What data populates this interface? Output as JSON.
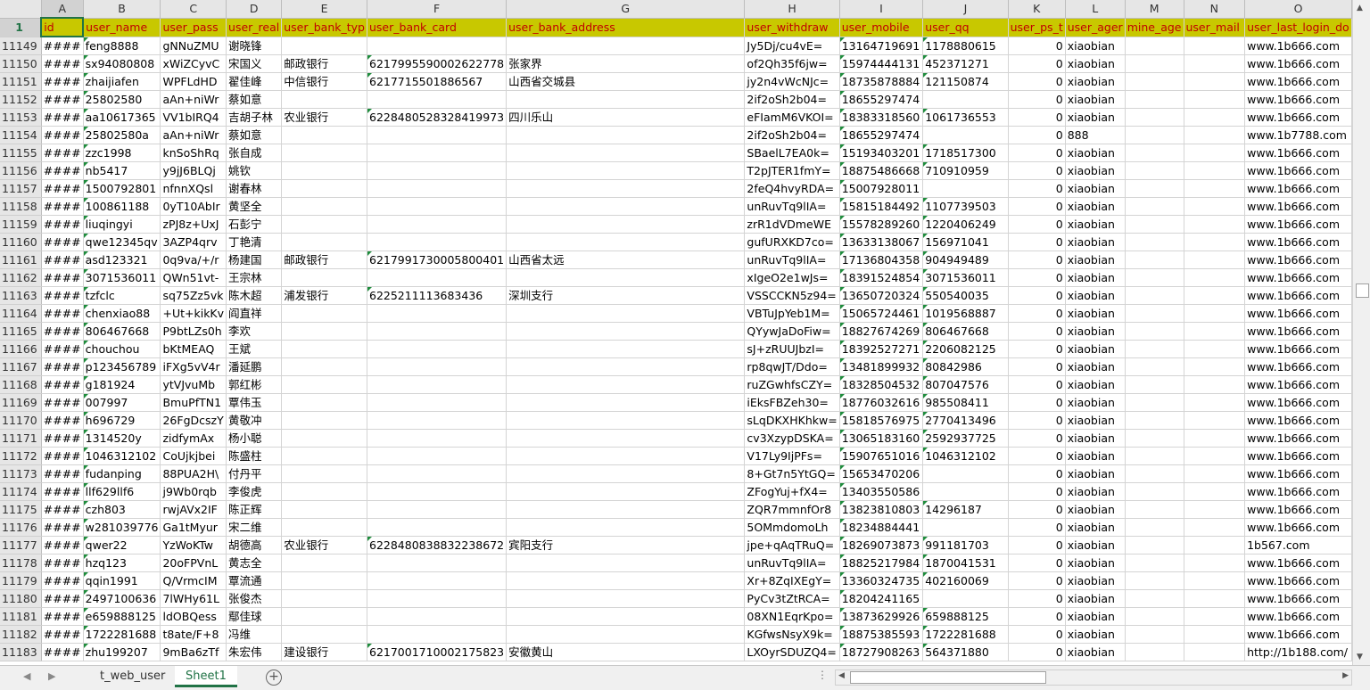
{
  "columns": [
    "A",
    "B",
    "C",
    "D",
    "E",
    "F",
    "G",
    "H",
    "I",
    "J",
    "K",
    "L",
    "M",
    "N",
    "O"
  ],
  "header_row_number": "1",
  "header": [
    "id",
    "user_name",
    "user_pass",
    "user_real",
    "user_bank_typ",
    "user_bank_card",
    "user_bank_address",
    "user_withdraw",
    "user_mobile",
    "user_qq",
    "user_ps_t",
    "user_ager",
    "mine_age",
    "user_mail",
    "user_last_login_do"
  ],
  "rows": [
    {
      "n": "11149",
      "c": [
        "####",
        "feng8888",
        "gNNuZMU",
        "谢晓锋",
        "",
        "",
        "",
        "Jy5Dj/cu4vE=",
        "13164719691",
        "1178880615",
        "0",
        "xiaobian",
        "",
        "",
        "www.1b666.com"
      ]
    },
    {
      "n": "11150",
      "c": [
        "####",
        "sx94080808",
        "xWiZCyvC",
        "宋国义",
        "邮政银行",
        "6217995590002622778",
        "张家界",
        "of2Qh35f6jw=",
        "15974444131",
        "452371271",
        "0",
        "xiaobian",
        "",
        "",
        "www.1b666.com"
      ]
    },
    {
      "n": "11151",
      "c": [
        "####",
        "zhaijiafen",
        "WPFLdHD",
        "翟佳峰",
        "中信银行",
        "621771550188​6567",
        "山西省交城县",
        "jy2n4vWcNJc=",
        "18735878884",
        "121150874",
        "0",
        "xiaobian",
        "",
        "",
        "www.1b666.com"
      ]
    },
    {
      "n": "11152",
      "c": [
        "####",
        "25802580",
        "aAn+niWr",
        "蔡如意",
        "",
        "",
        "",
        "2if2oSh2b04=",
        "18655297474",
        "",
        "0",
        "xiaobian",
        "",
        "",
        "www.1b666.com"
      ]
    },
    {
      "n": "11153",
      "c": [
        "####",
        "aa10617365",
        "VV1bIRQ4",
        "吉胡子林",
        "农业银行",
        "6228480528328419973",
        "四川乐山",
        "eFIamM6VKOI=",
        "18383318560",
        "1061736553",
        "0",
        "xiaobian",
        "",
        "",
        "www.1b666.com"
      ]
    },
    {
      "n": "11154",
      "c": [
        "####",
        "25802580a",
        "aAn+niWr",
        "蔡如意",
        "",
        "",
        "",
        "2if2oSh2b04=",
        "18655297474",
        "",
        "0",
        "888",
        "",
        "",
        "www.1b7788.com"
      ]
    },
    {
      "n": "11155",
      "c": [
        "####",
        "zzc1998",
        "knSoShRq",
        "张自成",
        "",
        "",
        "",
        "SBaelL7EA0k=",
        "15193403201",
        "1718517300",
        "0",
        "xiaobian",
        "",
        "",
        "www.1b666.com"
      ]
    },
    {
      "n": "11156",
      "c": [
        "####",
        "nb5417",
        "y9jJ6BLQj",
        "姚钦",
        "",
        "",
        "",
        "T2pJTER1fmY=",
        "18875486668",
        "710910959",
        "0",
        "xiaobian",
        "",
        "",
        "www.1b666.com"
      ]
    },
    {
      "n": "11157",
      "c": [
        "####",
        "1500792801",
        "nfnnXQsl",
        "谢春林",
        "",
        "",
        "",
        "2feQ4hvyRDA=",
        "15007928011",
        "",
        "0",
        "xiaobian",
        "",
        "",
        "www.1b666.com"
      ]
    },
    {
      "n": "11158",
      "c": [
        "####",
        "100861188",
        "0yT10AbIr",
        "黄坚全",
        "",
        "",
        "",
        "unRuvTq9lIA=",
        "15815184492",
        "1107739503",
        "0",
        "xiaobian",
        "",
        "",
        "www.1b666.com"
      ]
    },
    {
      "n": "11159",
      "c": [
        "####",
        "liuqingyi",
        "zPJ8z+UxJ",
        "石彭宁",
        "",
        "",
        "",
        "zrR1dVDmeWE",
        "15578289260",
        "1220406249",
        "0",
        "xiaobian",
        "",
        "",
        "www.1b666.com"
      ]
    },
    {
      "n": "11160",
      "c": [
        "####",
        "qwe12345qv",
        "3AZP4qrv",
        "丁艳清",
        "",
        "",
        "",
        "gufURXKD7co=",
        "13633138067",
        "156971041",
        "0",
        "xiaobian",
        "",
        "",
        "www.1b666.com"
      ]
    },
    {
      "n": "11161",
      "c": [
        "####",
        "asd123321",
        "0q9va/+/r",
        "杨建国",
        "邮政银行",
        "6217991730005800401",
        "山西省太远",
        "unRuvTq9lIA=",
        "17136804358",
        "904949489",
        "0",
        "xiaobian",
        "",
        "",
        "www.1b666.com"
      ]
    },
    {
      "n": "11162",
      "c": [
        "####",
        "3071536011",
        "QWn51vt-",
        "王宗林",
        "",
        "",
        "",
        "xIgeO2e1wJs=",
        "18391524854",
        "3071536011",
        "0",
        "xiaobian",
        "",
        "",
        "www.1b666.com"
      ]
    },
    {
      "n": "11163",
      "c": [
        "####",
        "tzfclc",
        "sq75Zz5vk",
        "陈木超",
        "浦发银行",
        "6225211113683436",
        "深圳支行",
        "VSSCCKN5z94=",
        "13650720324",
        "550540035",
        "0",
        "xiaobian",
        "",
        "",
        "www.1b666.com"
      ]
    },
    {
      "n": "11164",
      "c": [
        "####",
        "chenxiao88",
        "+Ut+kikKv",
        "阎直祥",
        "",
        "",
        "",
        "VBTuJpYeb1M=",
        "15065724461",
        "1019568887",
        "0",
        "xiaobian",
        "",
        "",
        "www.1b666.com"
      ]
    },
    {
      "n": "11165",
      "c": [
        "####",
        "806467668",
        "P9btLZs0h",
        "李欢",
        "",
        "",
        "",
        "QYywJaDoFiw=",
        "18827674269",
        "806467668",
        "0",
        "xiaobian",
        "",
        "",
        "www.1b666.com"
      ]
    },
    {
      "n": "11166",
      "c": [
        "####",
        "chouchou",
        "bKtMEAQ",
        "王斌",
        "",
        "",
        "",
        "sJ+zRUUJbzI=",
        "18392527271",
        "2206082125",
        "0",
        "xiaobian",
        "",
        "",
        "www.1b666.com"
      ]
    },
    {
      "n": "11167",
      "c": [
        "####",
        "p123456789",
        "iFXg5vV4r",
        "潘延鹏",
        "",
        "",
        "",
        "rp8qwJT/Ddo=",
        "13481899932",
        "80842986",
        "0",
        "xiaobian",
        "",
        "",
        "www.1b666.com"
      ]
    },
    {
      "n": "11168",
      "c": [
        "####",
        "g181924",
        "ytVJvuMb",
        "郭红彬",
        "",
        "",
        "",
        "ruZGwhfsCZY=",
        "18328504532",
        "807047576",
        "0",
        "xiaobian",
        "",
        "",
        "www.1b666.com"
      ]
    },
    {
      "n": "11169",
      "c": [
        "####",
        "007997",
        "BmuPfTN1",
        "覃伟玉",
        "",
        "",
        "",
        "iEksFBZeh30=",
        "18776032616",
        "985508411",
        "0",
        "xiaobian",
        "",
        "",
        "www.1b666.com"
      ]
    },
    {
      "n": "11170",
      "c": [
        "####",
        "h696729",
        "26FgDcszY",
        "黄敬冲",
        "",
        "",
        "",
        "sLqDKXHKhkw=",
        "15818576975",
        "2770413496",
        "0",
        "xiaobian",
        "",
        "",
        "www.1b666.com"
      ]
    },
    {
      "n": "11171",
      "c": [
        "####",
        "1314520y",
        "zidfymAx",
        "杨小聪",
        "",
        "",
        "",
        "cv3XzypDSKA=",
        "13065183160",
        "2592937725",
        "0",
        "xiaobian",
        "",
        "",
        "www.1b666.com"
      ]
    },
    {
      "n": "11172",
      "c": [
        "####",
        "1046312102",
        "CoUjkjbei",
        "陈盛柱",
        "",
        "",
        "",
        "V17Ly9IjPFs=",
        "15907651016",
        "1046312102",
        "0",
        "xiaobian",
        "",
        "",
        "www.1b666.com"
      ]
    },
    {
      "n": "11173",
      "c": [
        "####",
        "fudanping",
        "88PUA2H\\",
        "付丹平",
        "",
        "",
        "",
        "8+Gt7n5YtGQ=",
        "15653470206",
        "",
        "0",
        "xiaobian",
        "",
        "",
        "www.1b666.com"
      ]
    },
    {
      "n": "11174",
      "c": [
        "####",
        "llf629llf6",
        "j9Wb0rqb",
        "李俊虎",
        "",
        "",
        "",
        "ZFogYuj+fX4=",
        "13403550586",
        "",
        "0",
        "xiaobian",
        "",
        "",
        "www.1b666.com"
      ]
    },
    {
      "n": "11175",
      "c": [
        "####",
        "czh803",
        "rwjAVx2IF",
        "陈正辉",
        "",
        "",
        "",
        "ZQR7mmnfOr8",
        "13823810803",
        "14296187",
        "0",
        "xiaobian",
        "",
        "",
        "www.1b666.com"
      ]
    },
    {
      "n": "11176",
      "c": [
        "####",
        "w281039776",
        "Ga1tMyur",
        "宋二维",
        "",
        "",
        "",
        "5OMmdomoLh",
        "18234884441",
        "",
        "0",
        "xiaobian",
        "",
        "",
        "www.1b666.com"
      ]
    },
    {
      "n": "11177",
      "c": [
        "####",
        "qwer22",
        "YzWoKTw",
        "胡德高",
        "农业银行",
        "6228480838832238672",
        "宾阳支行",
        "jpe+qAqTRuQ=",
        "18269073873",
        "991181703",
        "0",
        "xiaobian",
        "",
        "",
        "1b567.com"
      ]
    },
    {
      "n": "11178",
      "c": [
        "####",
        "hzq123",
        "20oFPVnL",
        "黄志全",
        "",
        "",
        "",
        "unRuvTq9lIA=",
        "18825217984",
        "1870041531",
        "0",
        "xiaobian",
        "",
        "",
        "www.1b666.com"
      ]
    },
    {
      "n": "11179",
      "c": [
        "####",
        "qqin1991",
        "Q/VrmcIM",
        "覃流通",
        "",
        "",
        "",
        "Xr+8ZqIXEgY=",
        "13360324735",
        "402160069",
        "0",
        "xiaobian",
        "",
        "",
        "www.1b666.com"
      ]
    },
    {
      "n": "11180",
      "c": [
        "####",
        "2497100636",
        "7lWHy61L",
        "张俊杰",
        "",
        "",
        "",
        "PyCv3tZtRCA=",
        "18204241165",
        "",
        "0",
        "xiaobian",
        "",
        "",
        "www.1b666.com"
      ]
    },
    {
      "n": "11181",
      "c": [
        "####",
        "e659888125",
        "ldOBQess",
        "鄢佳球",
        "",
        "",
        "",
        "08XN1EqrKpo=",
        "13873629926",
        "659888125",
        "0",
        "xiaobian",
        "",
        "",
        "www.1b666.com"
      ]
    },
    {
      "n": "11182",
      "c": [
        "####",
        "1722281688",
        "t8ate/F+8",
        "冯维",
        "",
        "",
        "",
        "KGfwsNsyX9k=",
        "18875385593",
        "1722281688",
        "0",
        "xiaobian",
        "",
        "",
        "www.1b666.com"
      ]
    },
    {
      "n": "11183",
      "c": [
        "####",
        "zhu199207",
        "9mBa6zTf",
        "朱宏伟",
        "建设银行",
        "6217001710002175823",
        "安徽黄山",
        "LXOyrSDUZQ4=",
        "18727908263",
        "564371880",
        "0",
        "xiaobian",
        "",
        "",
        "http://1b188.com/"
      ]
    }
  ],
  "sheet_tabs": [
    "t_web_user",
    "Sheet1"
  ],
  "active_tab": "Sheet1",
  "icons": {
    "add_sheet": "plus-circle-icon",
    "prev": "left-arrow-icon",
    "next": "right-arrow-icon"
  }
}
